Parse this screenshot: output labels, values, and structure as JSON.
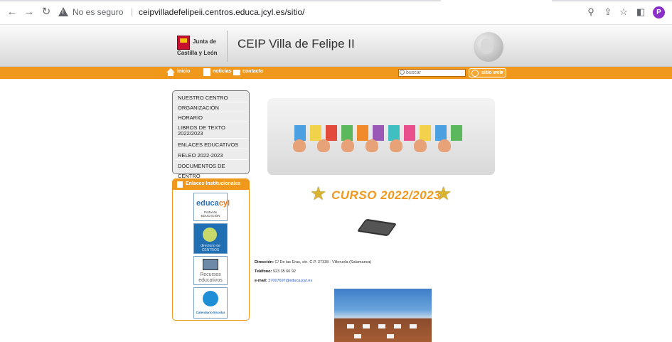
{
  "browser": {
    "insecure_label": "No es seguro",
    "url": "ceipvilladefelipeii.centros.educa.jcyl.es/sitio/",
    "profile_initial": "P"
  },
  "header": {
    "logo_line1": "Junta de",
    "logo_line2": "Castilla y León",
    "title": "CEIP Villa de Felipe II"
  },
  "topnav": {
    "inicio": "inicio",
    "noticias": "noticias",
    "contacto": "contacto",
    "search_placeholder": "buscar",
    "sitio_web": "sitio web"
  },
  "menu": [
    "NUESTRO CENTRO",
    "ORGANIZACIÓN",
    "HORARIO",
    "LIBROS DE TEXTO 2022/2023",
    "ENLACES EDUCATIVOS",
    "RELEO 2022-2023",
    "DOCUMENTOS DE CENTRO"
  ],
  "links": {
    "heading": "Enlaces Institucionales",
    "educacyl_1": "educa",
    "educacyl_2": "cyl",
    "educacyl_sub": "Portal de EDUCACIÓN",
    "directorio": "directorio de CENTROS",
    "recursos": "Recursos educativos",
    "calendario": "Calendario Escolar"
  },
  "main": {
    "curso": "CURSO 2022/2023",
    "direccion_label": "Dirección:",
    "direccion": "C/ De las Eras, s/n. C.P. 37338 - Villoruela (Salamanca)",
    "telefono_label": "Teléfono:",
    "telefono": "923 35 66 92",
    "email_label": "e-mail:",
    "email": "37007697@educa.jcyl.es"
  },
  "colors": {
    "accent": "#f0981b",
    "title_text": "#333333"
  }
}
